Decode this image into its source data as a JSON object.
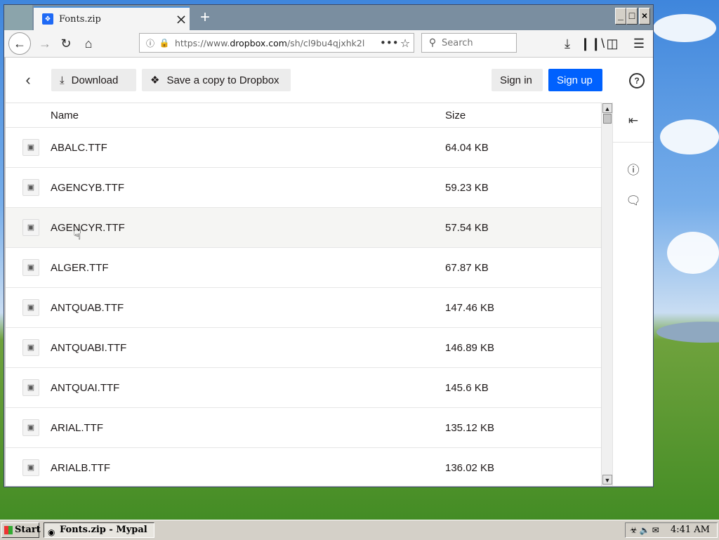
{
  "browser": {
    "tab_title": "Fonts.zip",
    "url_prefix": "https://www.",
    "url_domain": "dropbox.com",
    "url_rest": "/sh/cl9bu4qjxhk2l",
    "search_placeholder": "Search"
  },
  "toolbar": {
    "download_label": "Download",
    "save_copy_label": "Save a copy to Dropbox",
    "sign_in_label": "Sign in",
    "sign_up_label": "Sign up"
  },
  "columns": {
    "name": "Name",
    "size": "Size"
  },
  "files": [
    {
      "name": "ABALC.TTF",
      "size": "64.04 KB"
    },
    {
      "name": "AGENCYB.TTF",
      "size": "59.23 KB"
    },
    {
      "name": "AGENCYR.TTF",
      "size": "57.54 KB"
    },
    {
      "name": "ALGER.TTF",
      "size": "67.87 KB"
    },
    {
      "name": "ANTQUAB.TTF",
      "size": "147.46 KB"
    },
    {
      "name": "ANTQUABI.TTF",
      "size": "146.89 KB"
    },
    {
      "name": "ANTQUAI.TTF",
      "size": "145.6 KB"
    },
    {
      "name": "ARIAL.TTF",
      "size": "135.12 KB"
    },
    {
      "name": "ARIALB.TTF",
      "size": "136.02 KB"
    }
  ],
  "taskbar": {
    "start_label": "Start",
    "task_label": "Fonts.zip - Mypal",
    "clock": "4:41 AM"
  },
  "colors": {
    "accent": "#0061fe",
    "lock": "#26a83a"
  }
}
